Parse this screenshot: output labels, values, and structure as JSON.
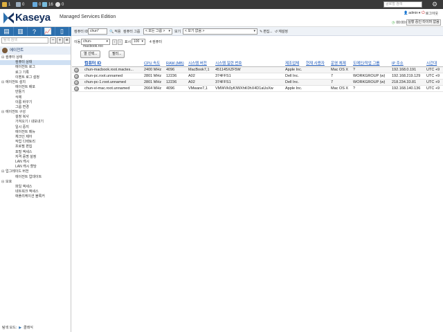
{
  "statusbar": {
    "counts": [
      "1",
      "0",
      "0",
      "16",
      "0"
    ],
    "search_placeholder": "글로벌 검색"
  },
  "header": {
    "logo_text": "Kaseya",
    "edition": "Managed Services Edition",
    "user": "admin",
    "user_caret": "▾",
    "logout": "로그아웃",
    "timer": "00:00:00",
    "pending": "실행 중인 타이머 없음"
  },
  "nav": {
    "search_placeholder": "탐색 검색",
    "module": "에이전트",
    "tree": [
      {
        "type": "group",
        "label": "컴퓨터 상태"
      },
      {
        "type": "item",
        "label": "컴퓨터 상태",
        "selected": true
      },
      {
        "type": "item",
        "label": "에이전트 로그"
      },
      {
        "type": "item",
        "label": "로그 기록"
      },
      {
        "type": "item",
        "label": "이벤트 로그 설정"
      },
      {
        "type": "group",
        "label": "에이전트 설치"
      },
      {
        "type": "item",
        "label": "에이전트 배포"
      },
      {
        "type": "item",
        "label": "만들기"
      },
      {
        "type": "item",
        "label": "삭제"
      },
      {
        "type": "item",
        "label": "이름 바꾸기"
      },
      {
        "type": "item",
        "label": "그룹 변경"
      },
      {
        "type": "group",
        "label": "에이전트 구성"
      },
      {
        "type": "item",
        "label": "설정 복사"
      },
      {
        "type": "item",
        "label": "가져오기 / 내보내기"
      },
      {
        "type": "item",
        "label": "일시 중지"
      },
      {
        "type": "item",
        "label": "에이전트 메뉴"
      },
      {
        "type": "item",
        "label": "체크인 제어"
      },
      {
        "type": "item",
        "label": "작업 디렉토리"
      },
      {
        "type": "item",
        "label": "프로필 편집"
      },
      {
        "type": "item",
        "label": "포털 액세스"
      },
      {
        "type": "item",
        "label": "자격 증명 설정"
      },
      {
        "type": "item",
        "label": "LAN 캐시"
      },
      {
        "type": "item",
        "label": "LAN 캐시 할당"
      },
      {
        "type": "group",
        "label": "업그레이드 버전"
      },
      {
        "type": "item",
        "label": "에이전트 업데이트"
      },
      {
        "type": "group",
        "label": "보호"
      },
      {
        "type": "item",
        "label": "파일 액세스"
      },
      {
        "type": "item",
        "label": "네트워크 액세스"
      },
      {
        "type": "item",
        "label": "애플리케이션 블록커"
      }
    ],
    "footer_label": "탐색 모드:",
    "footer_value": "클래식"
  },
  "filters": {
    "machine_id_label": "컴퓨터 ID",
    "machine_id_value": "chun*",
    "apply_label": "적용",
    "group_label": "컴퓨터 그룹",
    "group_value": "< 모든 그룹 >",
    "view_label": "보기",
    "view_value": "< 보기 없음 >",
    "edit_label": "편집...",
    "reset_label": "재설정",
    "goto_label": "이동",
    "goto_value": "chun-macbook.roo",
    "show_label": "표시",
    "show_value": "100",
    "count_text": "4 컴퓨터"
  },
  "buttons": {
    "select_columns": "열 선택...",
    "filter": "필터..."
  },
  "table": {
    "headers": [
      "컴퓨터 ID",
      "CPU 속도",
      "RAM (MB)",
      "시스템 버전",
      "시스템 일련 번호",
      "제조업체",
      "현재 사용자",
      "운영 체제",
      "도메인/작업 그룹",
      "IP 주소",
      "시간대"
    ],
    "rows": [
      [
        "chun-macbook.root.mactes...",
        "2400 MHz",
        "4096",
        "MacBook7,1",
        "451145XZF5W",
        "Apple Inc.",
        "",
        "Mac OS X",
        "?",
        "192.168.0.191",
        "UTC +9"
      ],
      [
        "chun-pc.root.unnamed",
        "2801 MHz",
        "12236",
        "A02",
        "374FFS1",
        "Dell Inc.",
        "",
        "7",
        "WORKGROUP (w)",
        "192.168.219.129",
        "UTC +9"
      ],
      [
        "chun-pc-1.root.unnamed",
        "2801 MHz",
        "12236",
        "A02",
        "374FFS1",
        "Dell Inc.",
        "",
        "7",
        "WORKGROUP (w)",
        "218.234.33.81",
        "UTC +9"
      ],
      [
        "chun-vi-mac.root.unnamed",
        "2664 MHz",
        "4096",
        "VMware7,1",
        "VMWVk0yKIWXhK0hX4D1aUsXw",
        "Apple Inc.",
        "",
        "Mac OS X",
        "?",
        "192.168.140.136",
        "UTC +9"
      ]
    ]
  },
  "colors": {
    "nav_bar": "#2c6fad",
    "link_blue": "#1a56b8",
    "brand": "#14305e"
  }
}
